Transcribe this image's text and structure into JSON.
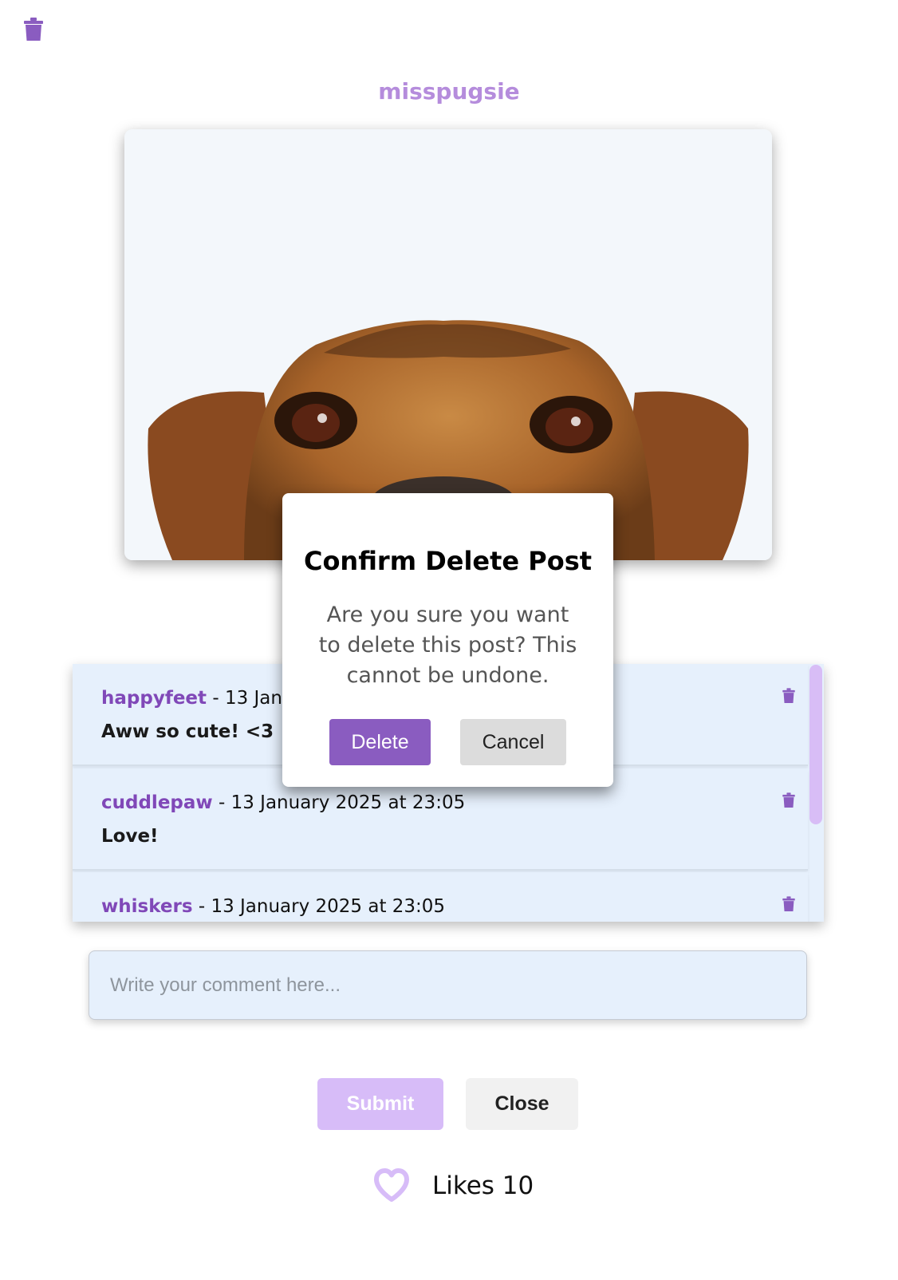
{
  "post": {
    "username": "misspugsie",
    "delete_icon": "trash-icon",
    "image": {
      "subject": "dog-peeking-photo"
    }
  },
  "comments": [
    {
      "author": "happyfeet",
      "date": "- 13 January 2025 at 23:05",
      "text": "Aww so cute! <3",
      "delete_icon": "trash-icon"
    },
    {
      "author": "cuddlepaw",
      "date": "- 13 January 2025 at 23:05",
      "text": "Love!",
      "delete_icon": "trash-icon"
    },
    {
      "author": "whiskers",
      "date": "- 13 January 2025 at 23:05",
      "text": "",
      "delete_icon": "trash-icon"
    }
  ],
  "comment_input": {
    "placeholder": "Write your comment here..."
  },
  "actions": {
    "submit_label": "Submit",
    "close_label": "Close"
  },
  "likes": {
    "label": "Likes 10",
    "icon": "heart-outline-icon"
  },
  "modal": {
    "title": "Confirm Delete Post",
    "message": "Are you sure you want to delete this post? This cannot be undone.",
    "delete_label": "Delete",
    "cancel_label": "Cancel"
  },
  "colors": {
    "accent": "#8a5cc0",
    "username": "#b58cdc",
    "author": "#8048b8",
    "comment_bg": "#e6f0fc",
    "submit_bg": "#d7bcf8",
    "scrollbar": "#d8bdf6"
  }
}
